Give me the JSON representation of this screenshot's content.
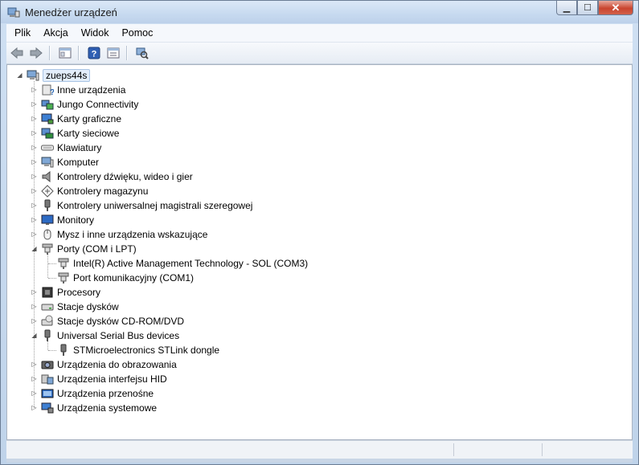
{
  "window": {
    "title": "Menedżer urządzeń",
    "caption": {
      "minimize": "▁",
      "maximize": "☐",
      "close": "✕"
    }
  },
  "menu": [
    {
      "label": "Plik"
    },
    {
      "label": "Akcja"
    },
    {
      "label": "Widok"
    },
    {
      "label": "Pomoc"
    }
  ],
  "toolbar": [
    {
      "name": "back-button",
      "icon": "arrow-left-icon"
    },
    {
      "name": "forward-button",
      "icon": "arrow-right-icon"
    },
    {
      "name": "show-hide-console-tree-button",
      "icon": "console-tree-icon"
    },
    {
      "name": "help-button",
      "icon": "help-icon"
    },
    {
      "name": "properties-button",
      "icon": "properties-icon"
    },
    {
      "name": "scan-hardware-button",
      "icon": "scan-hardware-icon"
    }
  ],
  "tree": {
    "root": {
      "label": "zueps44s",
      "expanded": true,
      "icon": "computer-icon"
    },
    "items": [
      {
        "label": "Inne urządzenia",
        "icon": "unknown-device-icon",
        "expanded": false
      },
      {
        "label": "Jungo Connectivity",
        "icon": "network-device-icon",
        "expanded": false
      },
      {
        "label": "Karty graficzne",
        "icon": "display-adapter-icon",
        "expanded": false
      },
      {
        "label": "Karty sieciowe",
        "icon": "network-adapter-icon",
        "expanded": false
      },
      {
        "label": "Klawiatury",
        "icon": "keyboard-icon",
        "expanded": false
      },
      {
        "label": "Komputer",
        "icon": "computer-icon",
        "expanded": false
      },
      {
        "label": "Kontrolery dźwięku, wideo i gier",
        "icon": "speaker-icon",
        "expanded": false
      },
      {
        "label": "Kontrolery magazynu",
        "icon": "storage-controller-icon",
        "expanded": false
      },
      {
        "label": "Kontrolery uniwersalnej magistrali szeregowej",
        "icon": "usb-plug-icon",
        "expanded": false
      },
      {
        "label": "Monitory",
        "icon": "monitor-icon",
        "expanded": false
      },
      {
        "label": "Mysz i inne urządzenia wskazujące",
        "icon": "mouse-icon",
        "expanded": false
      },
      {
        "label": "Porty (COM i LPT)",
        "icon": "port-icon",
        "expanded": true,
        "children": [
          {
            "label": "Intel(R) Active Management Technology - SOL (COM3)",
            "icon": "port-icon"
          },
          {
            "label": "Port komunikacyjny (COM1)",
            "icon": "port-icon"
          }
        ]
      },
      {
        "label": "Procesory",
        "icon": "processor-icon",
        "expanded": false
      },
      {
        "label": "Stacje dysków",
        "icon": "disk-drive-icon",
        "expanded": false
      },
      {
        "label": "Stacje dysków CD-ROM/DVD",
        "icon": "cdrom-drive-icon",
        "expanded": false
      },
      {
        "label": "Universal Serial Bus devices",
        "icon": "usb-plug-icon",
        "expanded": true,
        "children": [
          {
            "label": "STMicroelectronics STLink dongle",
            "icon": "usb-plug-icon"
          }
        ]
      },
      {
        "label": "Urządzenia do obrazowania",
        "icon": "camera-icon",
        "expanded": false
      },
      {
        "label": "Urządzenia interfejsu HID",
        "icon": "hid-device-icon",
        "expanded": false
      },
      {
        "label": "Urządzenia przenośne",
        "icon": "portable-device-icon",
        "expanded": false
      },
      {
        "label": "Urządzenia systemowe",
        "icon": "system-device-icon",
        "expanded": false
      }
    ]
  },
  "colors": {
    "accent": "#3a6ea5",
    "selection": "#e3eefb",
    "close": "#c9452f"
  }
}
